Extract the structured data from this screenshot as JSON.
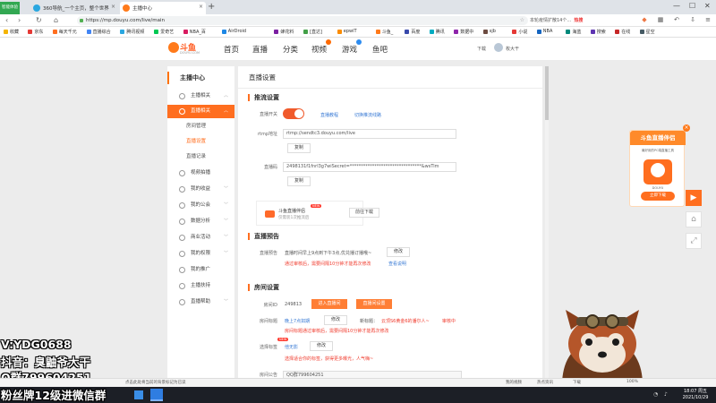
{
  "browser": {
    "badge": "智能体验",
    "tabs": [
      {
        "label": "360导航_一个主页，整个世界",
        "active": false
      },
      {
        "label": "主播中心",
        "active": true
      }
    ],
    "new_tab": "+",
    "url": "https://mp.douyu.com/live/main",
    "search_hint": "本轮疫情扩散14个…",
    "search_hot": "热搜",
    "window_controls": [
      "—",
      "☐",
      "✕"
    ],
    "bookmarks": [
      "收藏",
      "京东",
      "每天千元",
      "直播综合",
      "腾讯视频",
      "爱奇艺",
      "NBA_百",
      "AirDroid",
      "蜂花料",
      "[直达]",
      "epwiT",
      "斗鱼_",
      "百度",
      "腾讯",
      "数据中",
      "sjb",
      "小说",
      "NBA",
      "海蓝",
      "搜索",
      "在线",
      "星空"
    ]
  },
  "site": {
    "logo": "斗鱼",
    "logo_sub": "DOUYU.COM",
    "nav": [
      "首页",
      "直播",
      "分类",
      "视频",
      "游戏",
      "鱼吧"
    ],
    "download": "下载",
    "username": "枚大干"
  },
  "sidebar": {
    "title": "主播中心",
    "items": [
      {
        "label": "主播相关",
        "arrow": "︿"
      },
      {
        "label": "直播相关",
        "arrow": "︿",
        "active": true
      },
      {
        "label": "房间管理",
        "sub": true
      },
      {
        "label": "直播设置",
        "sub": true,
        "current": true
      },
      {
        "label": "直播记录",
        "sub": true
      },
      {
        "label": "视频拍播",
        "arrow": ""
      },
      {
        "label": "我的收益",
        "arrow": "﹀"
      },
      {
        "label": "我的公会",
        "arrow": "﹀"
      },
      {
        "label": "数据分析",
        "arrow": "﹀"
      },
      {
        "label": "商业活动",
        "arrow": "﹀"
      },
      {
        "label": "我的权限",
        "arrow": "﹀"
      },
      {
        "label": "我的推广",
        "arrow": ""
      },
      {
        "label": "主播扶持",
        "arrow": ""
      },
      {
        "label": "直播帮助",
        "arrow": "﹀"
      }
    ]
  },
  "main": {
    "title": "直播设置",
    "stream_section": "推流设置",
    "switch_label": "直播开关",
    "tutorial": "直播教程",
    "switch_mode": "切换推流线路",
    "rtmp_label": "rtmp地址",
    "rtmp_value": "rtmp://sendtc3.douyu.com/live",
    "copy": "复制",
    "code_label": "直播码",
    "code_value": "2498131f1fnrl3g7wiSecret=********************************&wsTim",
    "companion_title": "斗鱼直播伴侣",
    "companion_sub": "仅需装1次推流后",
    "new_badge": "NEW",
    "go_download": "前往下载",
    "notice_section": "直播预告",
    "notice_label": "直播预告",
    "notice_value": "直播时间早上9点到下午3点,优兑播订播哦~",
    "notice_edit": "修改",
    "notice_review": "通过审核后，需要间隔10分钟才能再次修改",
    "notice_view": "查看说明",
    "room_section": "房间设置",
    "room_id_label": "房间ID",
    "room_id": "249813",
    "enter_room": "进入直播间",
    "apply_room": "直播间设置",
    "room_title_label": "房间标题",
    "room_title": "晚上7点如期",
    "room_title_edit": "修改",
    "new_title_label": "新标题：",
    "new_title": "云顶S6黄金6的潘尔人~",
    "review_status": "审核中",
    "room_title_review": "房间标题通过审核后，需要间隔10分钟才能再次修改",
    "tags_label": "选择标签",
    "tags_value": "他无影",
    "tags_edit": "修改",
    "tags_hint": "选择适合你的标签，获得更多曝光，人气嗨~",
    "announce_label": "房间公告",
    "announce_value": "QQ群799604251"
  },
  "promo": {
    "title": "斗鱼直播伴侣",
    "desc": "最好用的PC端直播工具",
    "brand": "DOUYU",
    "button": "立即下载",
    "close": "×"
  },
  "overlay": {
    "lines": [
      "V:YDG0688",
      "抖音：臭鼬爷大干",
      "Q群799604251",
      "粉丝牌12级进微信群"
    ]
  },
  "status": {
    "left": "点击此处将当前的背景标记为已读",
    "right": [
      "我的视频",
      "热点资讯",
      "下载",
      "100%"
    ]
  },
  "taskbar": {
    "time": "18:07 周五",
    "date": "2021/10/29"
  }
}
